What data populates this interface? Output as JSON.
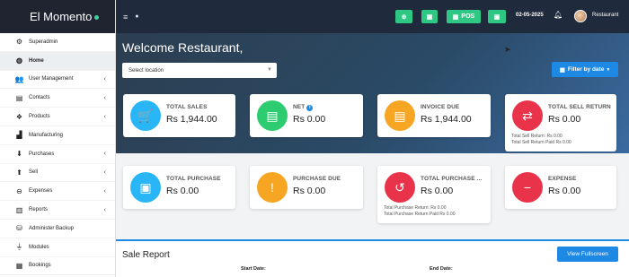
{
  "brand": {
    "name": "El Momento",
    "dot_color": "#3fd39a"
  },
  "sidebar": {
    "items": [
      {
        "label": "Superadmin",
        "icon": "users-cog-icon",
        "glyph": "⚙",
        "chevron": false,
        "active": false
      },
      {
        "label": "Home",
        "icon": "dashboard-icon",
        "glyph": "◍",
        "chevron": false,
        "active": true
      },
      {
        "label": "User Management",
        "icon": "users-icon",
        "glyph": "👥",
        "chevron": true,
        "active": false
      },
      {
        "label": "Contacts",
        "icon": "address-book-icon",
        "glyph": "▤",
        "chevron": true,
        "active": false
      },
      {
        "label": "Products",
        "icon": "cubes-icon",
        "glyph": "❖",
        "chevron": true,
        "active": false
      },
      {
        "label": "Manufacturing",
        "icon": "industry-icon",
        "glyph": "▟",
        "chevron": false,
        "active": false
      },
      {
        "label": "Purchases",
        "icon": "arrow-circle-down-icon",
        "glyph": "⬇",
        "chevron": true,
        "active": false
      },
      {
        "label": "Sell",
        "icon": "arrow-circle-up-icon",
        "glyph": "⬆",
        "chevron": true,
        "active": false
      },
      {
        "label": "Expenses",
        "icon": "minus-circle-icon",
        "glyph": "⊖",
        "chevron": true,
        "active": false
      },
      {
        "label": "Reports",
        "icon": "chart-bar-icon",
        "glyph": "▥",
        "chevron": true,
        "active": false
      },
      {
        "label": "Administer Backup",
        "icon": "database-icon",
        "glyph": "⛁",
        "chevron": false,
        "active": false
      },
      {
        "label": "Modules",
        "icon": "plug-icon",
        "glyph": "⏚",
        "chevron": false,
        "active": false
      },
      {
        "label": "Bookings",
        "icon": "calendar-check-icon",
        "glyph": "▦",
        "chevron": false,
        "active": false
      }
    ]
  },
  "topbar": {
    "menu_icon": "≡",
    "info_icon": "●",
    "buttons": [
      {
        "name": "add-button",
        "icon": "plus-circle-icon",
        "glyph": "⊕",
        "label": ""
      },
      {
        "name": "calculator-button",
        "icon": "calculator-icon",
        "glyph": "▦",
        "label": ""
      },
      {
        "name": "pos-button",
        "icon": "th-large-icon",
        "glyph": "▦",
        "label": "POS"
      },
      {
        "name": "cash-button",
        "icon": "money-bill-icon",
        "glyph": "▣",
        "label": ""
      }
    ],
    "date": "02-05-2025",
    "bell_icon": "bell-icon",
    "user": "Restaurant"
  },
  "hero": {
    "welcome": "Welcome Restaurant,",
    "location_placeholder": "Select location",
    "filter_label": "Filter by date"
  },
  "cards": [
    {
      "name": "total-sales",
      "label": "TOTAL SALES",
      "value": "Rs 1,944.00",
      "icon": "cart-icon",
      "glyph": "🛒",
      "color": "#29b6f6",
      "info": false,
      "sub": []
    },
    {
      "name": "net",
      "label": "NET",
      "value": "Rs 0.00",
      "icon": "clipboard-icon",
      "glyph": "▤",
      "color": "#2ecc71",
      "info": true,
      "sub": []
    },
    {
      "name": "invoice-due",
      "label": "INVOICE DUE",
      "value": "Rs 1,944.00",
      "icon": "file-invoice-icon",
      "glyph": "▤",
      "color": "#f6a623",
      "info": false,
      "sub": []
    },
    {
      "name": "total-sell-return",
      "label": "TOTAL SELL RETURN",
      "value": "Rs 0.00",
      "icon": "exchange-icon",
      "glyph": "⇄",
      "color": "#e8334a",
      "info": false,
      "sub": [
        "Total Sell Return: Rs 0.00",
        "Total Sell Return Paid Rs 0.00"
      ]
    },
    {
      "name": "total-purchase",
      "label": "TOTAL PURCHASE",
      "value": "Rs 0.00",
      "icon": "money-bill-wave-icon",
      "glyph": "▣",
      "color": "#29b6f6",
      "info": false,
      "sub": []
    },
    {
      "name": "purchase-due",
      "label": "PURCHASE DUE",
      "value": "Rs 0.00",
      "icon": "exclamation-icon",
      "glyph": "!",
      "color": "#f6a623",
      "info": false,
      "sub": []
    },
    {
      "name": "total-purchase-return",
      "label": "TOTAL PURCHASE ...",
      "value": "Rs 0.00",
      "icon": "undo-icon",
      "glyph": "↺",
      "color": "#e8334a",
      "info": false,
      "sub": [
        "Total Purchase Return: Rs 0.00",
        "Total Purchase Return Paid Rs 0.00"
      ]
    },
    {
      "name": "expense",
      "label": "EXPENSE",
      "value": "Rs 0.00",
      "icon": "minus-circle-icon",
      "glyph": "−",
      "color": "#e8334a",
      "info": false,
      "sub": []
    }
  ],
  "report": {
    "title": "Sale Report",
    "fullscreen_label": "View Fullscreen",
    "start_label": "Start Date:",
    "end_label": "End Date:"
  }
}
